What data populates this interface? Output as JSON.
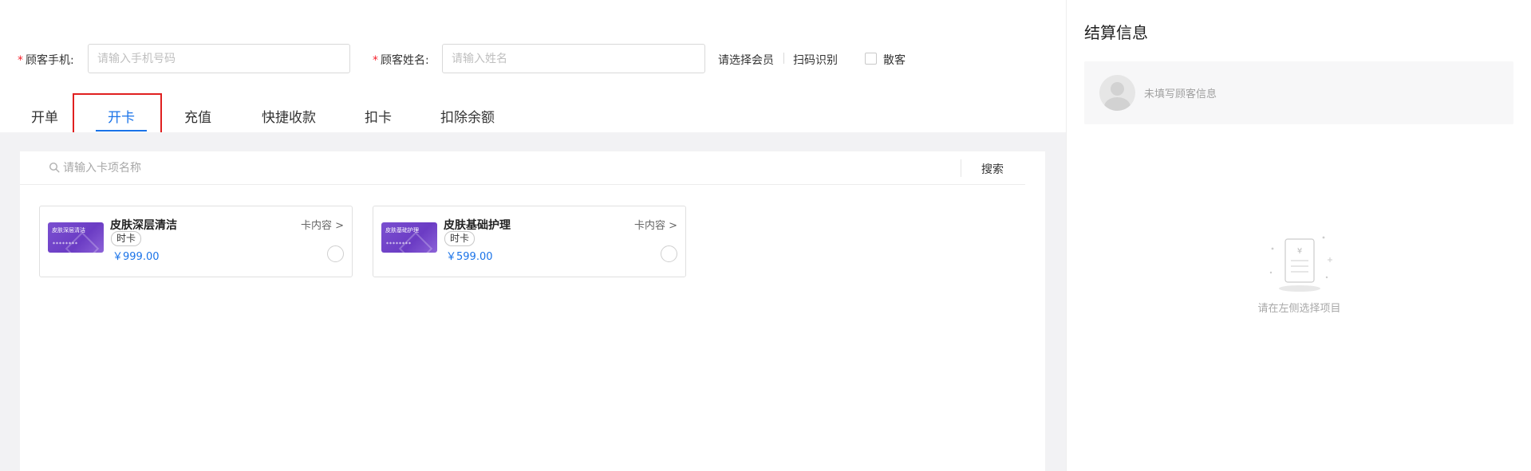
{
  "form": {
    "phone_label": "顾客手机:",
    "phone_placeholder": "请输入手机号码",
    "phone_value": "",
    "name_label": "顾客姓名:",
    "name_placeholder": "请输入姓名",
    "name_value": "",
    "required_mark": "*",
    "select_member_link": "请选择会员",
    "scan_link": "扫码识别",
    "walkin_label": "散客"
  },
  "tabs": [
    {
      "label": "开单",
      "active": false
    },
    {
      "label": "开卡",
      "active": true
    },
    {
      "label": "充值",
      "active": false
    },
    {
      "label": "快捷收款",
      "active": false
    },
    {
      "label": "扣卡",
      "active": false
    },
    {
      "label": "扣除余额",
      "active": false
    }
  ],
  "search": {
    "placeholder": "请输入卡项名称",
    "button_label": "搜索"
  },
  "cards": [
    {
      "title": "皮肤深层清洁",
      "thumb_name": "皮肤深层清洁",
      "thumb_dots": "********",
      "tag": "时卡",
      "price": "￥999.00",
      "content_link": "卡内容"
    },
    {
      "title": "皮肤基础护理",
      "thumb_name": "皮肤基础护理",
      "thumb_dots": "********",
      "tag": "时卡",
      "price": "￥599.00",
      "content_link": "卡内容"
    }
  ],
  "summary": {
    "title": "结算信息",
    "customer_placeholder": "未填写顾客信息",
    "empty_text": "请在左侧选择项目"
  },
  "colors": {
    "accent": "#1a73e8",
    "required": "#f5222d",
    "highlight_border": "#e02020",
    "card_purple": "#7a4fd0"
  }
}
